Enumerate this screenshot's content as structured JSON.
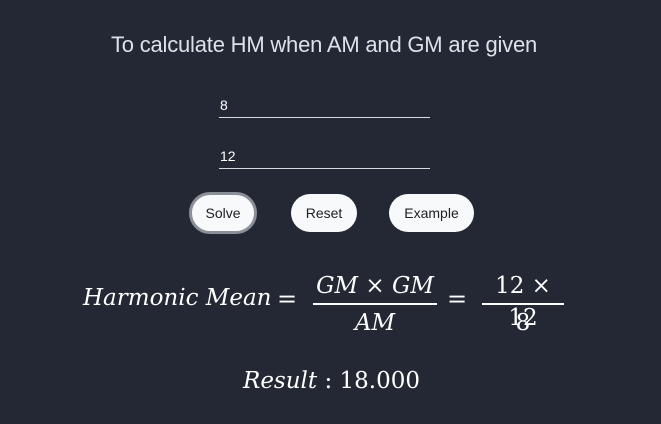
{
  "title": "To calculate HM when AM and GM are given",
  "inputs": {
    "first": {
      "value": "8"
    },
    "second": {
      "value": "12"
    }
  },
  "buttons": {
    "solve": "Solve",
    "reset": "Reset",
    "example": "Example"
  },
  "formula": {
    "lhs": "Harmonic Mean",
    "equals": "=",
    "frac1_num": "GM × GM",
    "frac1_den": "AM",
    "frac2_num": "12 × 12",
    "frac2_den": "8"
  },
  "result": {
    "label": "Result",
    "separator": ":",
    "value": "18.000"
  }
}
